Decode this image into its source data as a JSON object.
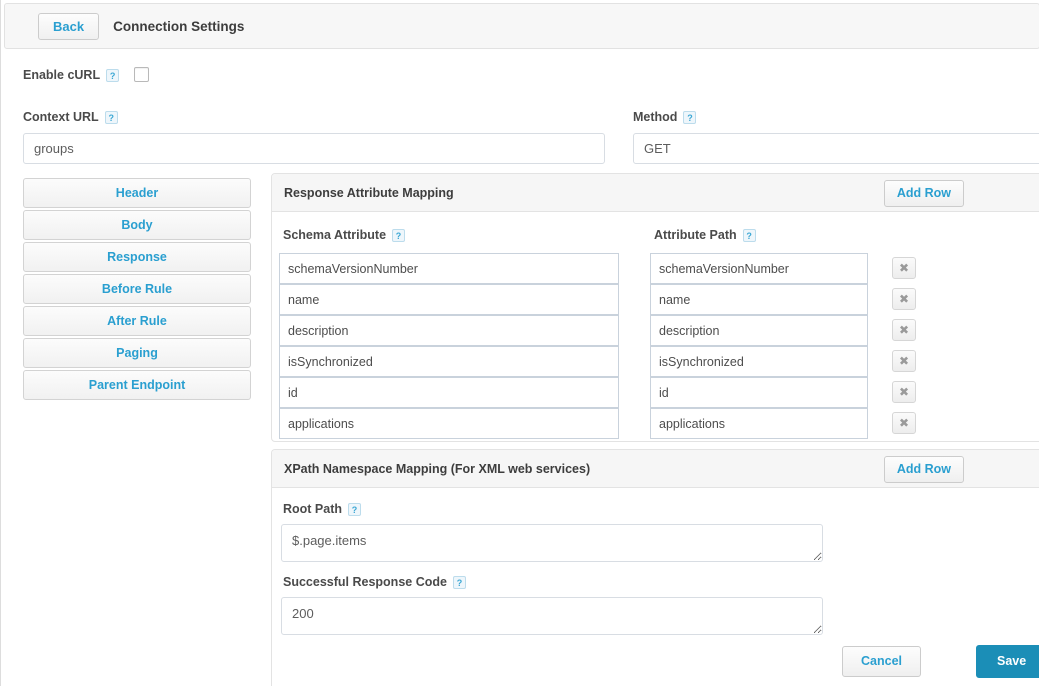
{
  "topbar": {
    "back_label": "Back",
    "title": "Connection Settings"
  },
  "form": {
    "enable_curl": {
      "label": "Enable cURL",
      "help": "?",
      "checked": false
    },
    "context_url": {
      "label": "Context URL",
      "help": "?",
      "value": "groups"
    },
    "method": {
      "label": "Method",
      "help": "?",
      "value": "GET"
    }
  },
  "sidebar": {
    "items": [
      {
        "label": "Header"
      },
      {
        "label": "Body"
      },
      {
        "label": "Response"
      },
      {
        "label": "Before Rule"
      },
      {
        "label": "After Rule"
      },
      {
        "label": "Paging"
      },
      {
        "label": "Parent Endpoint"
      }
    ]
  },
  "response_mapping": {
    "title": "Response Attribute Mapping",
    "add_row_label": "Add Row",
    "columns": [
      {
        "label": "Schema Attribute",
        "help": "?"
      },
      {
        "label": "Attribute Path",
        "help": "?"
      }
    ],
    "delete_icon": "✖",
    "rows": [
      {
        "schema_attribute": "schemaVersionNumber",
        "attribute_path": "schemaVersionNumber"
      },
      {
        "schema_attribute": "name",
        "attribute_path": "name"
      },
      {
        "schema_attribute": "description",
        "attribute_path": "description"
      },
      {
        "schema_attribute": "isSynchronized",
        "attribute_path": "isSynchronized"
      },
      {
        "schema_attribute": "id",
        "attribute_path": "id"
      },
      {
        "schema_attribute": "applications",
        "attribute_path": "applications"
      }
    ]
  },
  "xpath_mapping": {
    "title": "XPath Namespace Mapping (For XML web services)",
    "add_row_label": "Add Row",
    "root_path": {
      "label": "Root Path",
      "help": "?",
      "value": "$.page.items"
    },
    "response_code": {
      "label": "Successful Response Code",
      "help": "?",
      "value": "200"
    }
  },
  "footer": {
    "cancel_label": "Cancel",
    "save_label": "Save"
  },
  "colors": {
    "link": "#2a9fd0",
    "save_bg": "#1b8eb7",
    "panel_head_bg": "#f6f6f6",
    "border": "#e3e3e3"
  }
}
